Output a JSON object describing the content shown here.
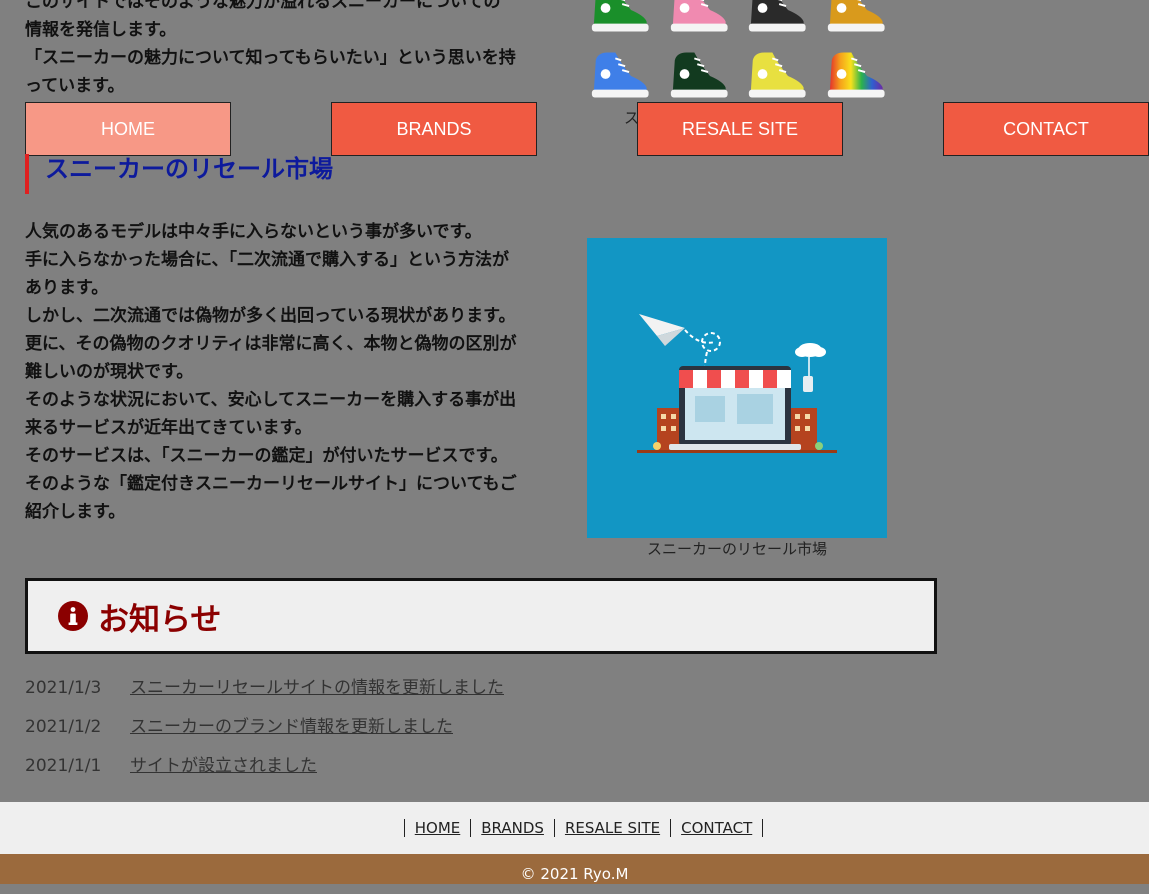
{
  "intro": {
    "line1": "このサイトではそのような魅力が溢れるスニーカーについての",
    "line2": "情報を発信します。",
    "line3": "「スニーカーの魅力について知ってもらいたい」という思いを持",
    "line4": "っています。"
  },
  "shoes": {
    "row1": [
      "#1a8f2a",
      "#f08ab0",
      "#2a2a2a",
      "#d99a1c"
    ],
    "row2": [
      "#3f7fe8",
      "#123a1f",
      "#e8e040",
      "rainbow"
    ],
    "caption": "ス"
  },
  "nav": {
    "items": [
      {
        "label": "HOME"
      },
      {
        "label": "BRANDS"
      },
      {
        "label": "RESALE SITE"
      },
      {
        "label": "CONTACT"
      }
    ],
    "colors": {
      "active": "#f79886",
      "default": "#f05a42"
    }
  },
  "section": {
    "title": "スニーカーのリセール市場"
  },
  "article": {
    "lines": [
      "人気のあるモデルは中々手に入らないという事が多いです。",
      "手に入らなかった場合に、「二次流通で購入する」という方法が",
      "あります。",
      "しかし、二次流通では偽物が多く出回っている現状があります。",
      "更に、その偽物のクオリティは非常に高く、本物と偽物の区別が",
      "難しいのが現状です。",
      "そのような状況において、安心してスニーカーを購入する事が出",
      "来るサービスが近年出てきています。",
      "そのサービスは、「スニーカーの鑑定」が付いたサービスです。",
      "そのような「鑑定付きスニーカーリセールサイト」についてもご",
      "紹介します。"
    ]
  },
  "illustration": {
    "caption": "スニーカーのリセール市場",
    "icon": "online-shop-laptop-illustration"
  },
  "notice": {
    "title": "お知らせ",
    "icon": "info-circle-icon"
  },
  "news": [
    {
      "date": "2021/1/3",
      "text": "スニーカーリセールサイトの情報を更新しました"
    },
    {
      "date": "2021/1/2",
      "text": "スニーカーのブランド情報を更新しました"
    },
    {
      "date": "2021/1/1",
      "text": "サイトが設立されました"
    }
  ],
  "footer": {
    "links": [
      {
        "label": "HOME"
      },
      {
        "label": "BRANDS"
      },
      {
        "label": "RESALE SITE"
      },
      {
        "label": "CONTACT"
      }
    ],
    "copyright": "© 2021 Ryo.M"
  }
}
